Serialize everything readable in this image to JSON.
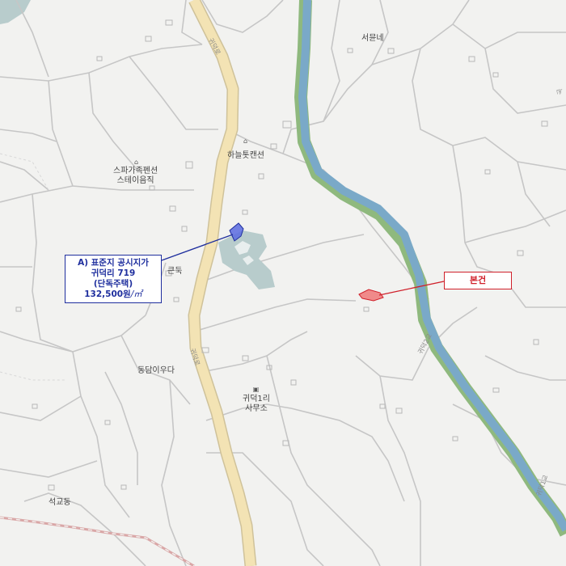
{
  "map": {
    "labels": {
      "place_north": "서뮨네",
      "place_camp": "하늘톳캔션",
      "place_pension_1": "스파가족펜션",
      "place_pension_2": "스테이음직",
      "place_eastmid": "큰둑",
      "place_mid": "동담이우다",
      "place_office_1": "귀덕1리",
      "place_office_2": "사무소",
      "place_sw": "석교동",
      "road_main_top": "귀덕로",
      "road_main_mid": "귀덕로",
      "road_river": "귀덕2교",
      "road_bottom_right": "귀덕1교",
      "edge_right": "논"
    },
    "subject_callout": {
      "line1": "A) 표준지 공시지가",
      "line2": "귀덕리 719",
      "line3": "(단독주택)",
      "price": "132,500원",
      "unit": "/㎡"
    },
    "target_callout": {
      "label": "본건"
    },
    "colors": {
      "background": "#f2f2f0",
      "road_main": "#f3e3b4",
      "road_main_edge": "#cfc29a",
      "river": "#7aa9c8",
      "riverbank": "#8fb97e",
      "pond": "#b8cccc",
      "subject": "#1f2f9e",
      "target": "#d0202a",
      "target_fill": "#f08a8a"
    }
  }
}
